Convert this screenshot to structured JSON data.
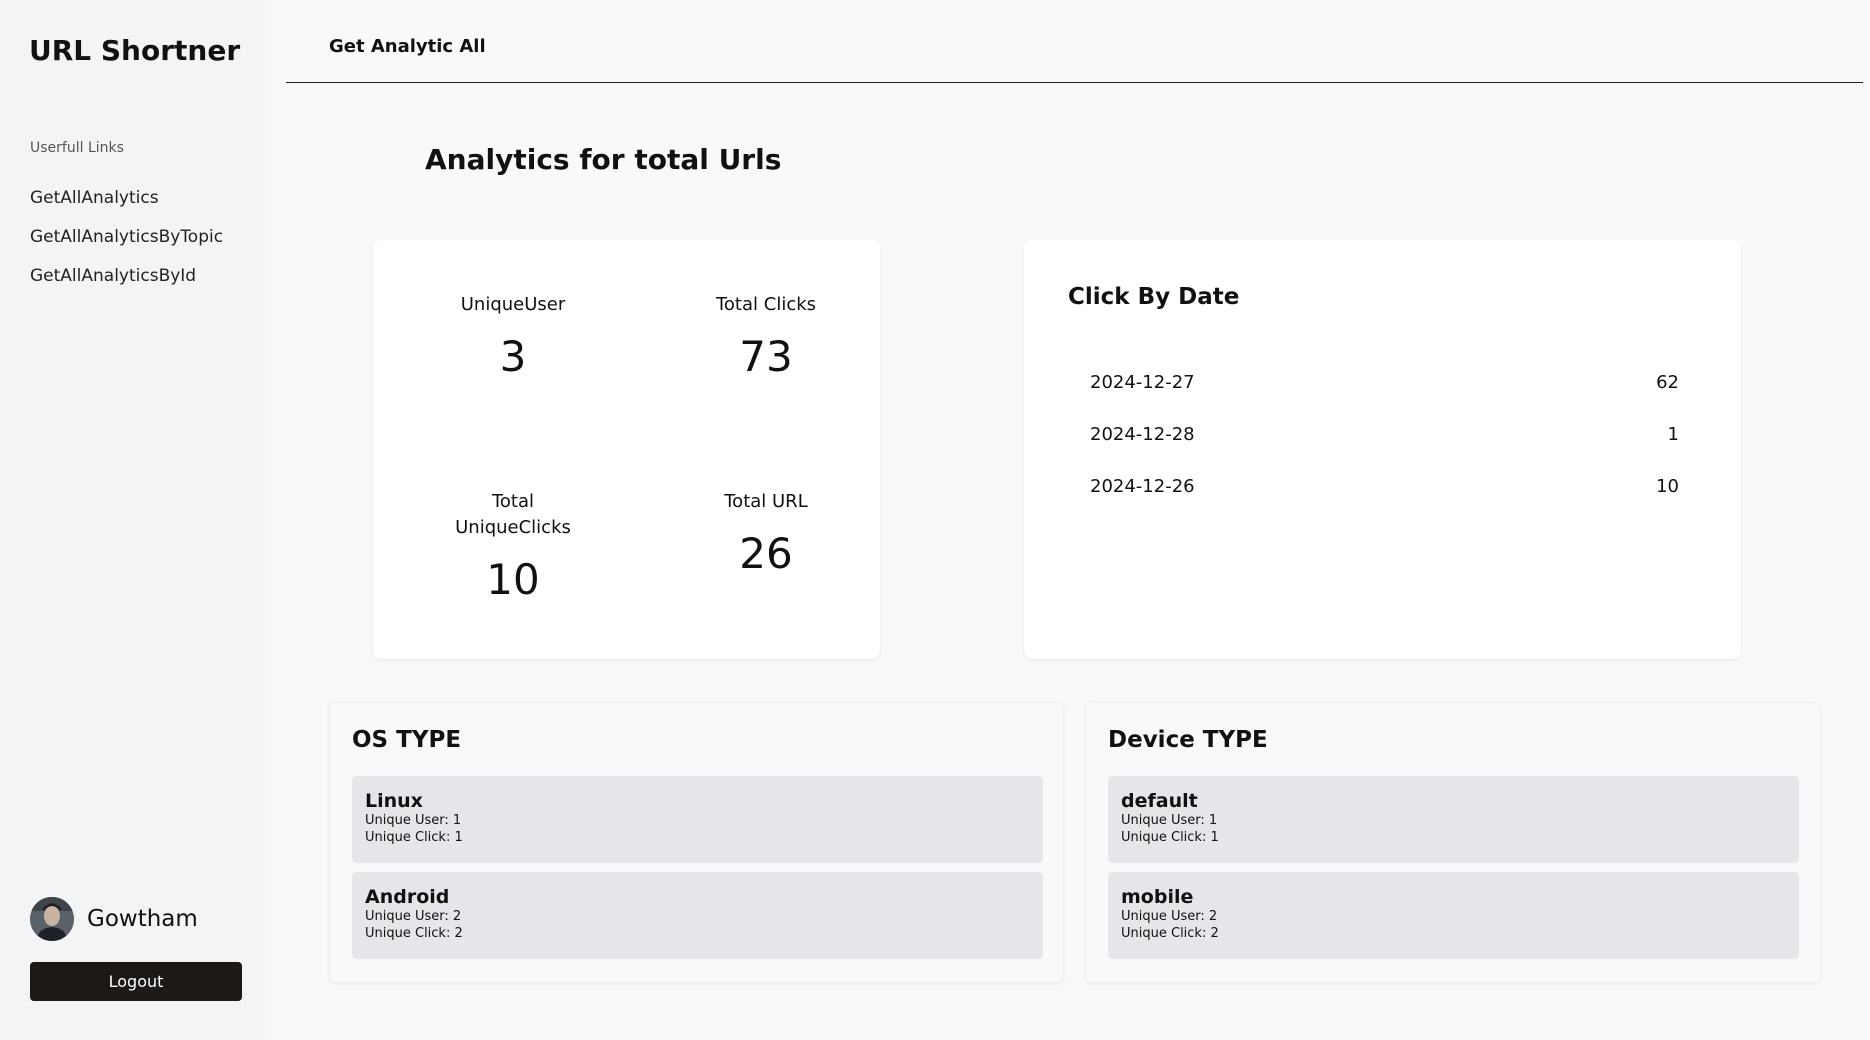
{
  "sidebar": {
    "brand": "URL Shortner",
    "links_heading": "Userfull Links",
    "items": [
      {
        "label": "GetAllAnalytics"
      },
      {
        "label": "GetAllAnalyticsByTopic"
      },
      {
        "label": "GetAllAnalyticsById"
      }
    ],
    "user_name": "Gowtham",
    "logout_label": "Logout"
  },
  "header": {
    "title": "Get Analytic All"
  },
  "main": {
    "page_title": "Analytics for total Urls",
    "stats": {
      "unique_user": {
        "label": "UniqueUser",
        "value": "3"
      },
      "total_clicks": {
        "label": "Total Clicks",
        "value": "73"
      },
      "total_unique_clicks": {
        "label": "Total UniqueClicks",
        "value": "10"
      },
      "total_url": {
        "label": "Total URL",
        "value": "26"
      }
    },
    "click_by_date": {
      "title": "Click By Date",
      "rows": [
        {
          "date": "2024-12-27",
          "count": "62"
        },
        {
          "date": "2024-12-28",
          "count": "1"
        },
        {
          "date": "2024-12-26",
          "count": "10"
        }
      ]
    },
    "os_type": {
      "title": "OS TYPE",
      "items": [
        {
          "name": "Linux",
          "unique_user": "Unique User: 1",
          "unique_click": "Unique Click: 1"
        },
        {
          "name": "Android",
          "unique_user": "Unique User: 2",
          "unique_click": "Unique Click: 2"
        }
      ]
    },
    "device_type": {
      "title": "Device TYPE",
      "items": [
        {
          "name": "default",
          "unique_user": "Unique User: 1",
          "unique_click": "Unique Click: 1"
        },
        {
          "name": "mobile",
          "unique_user": "Unique User: 2",
          "unique_click": "Unique Click: 2"
        }
      ]
    }
  }
}
